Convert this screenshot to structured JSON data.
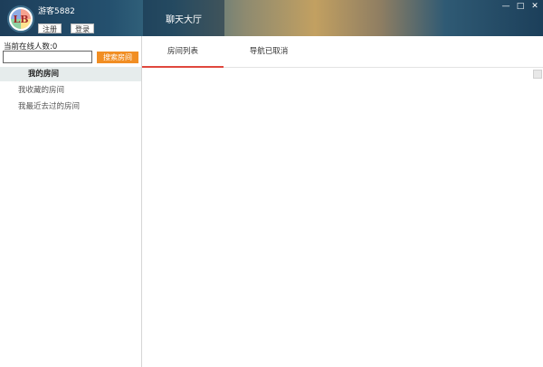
{
  "header": {
    "username": "游客5882",
    "register_label": "注册",
    "login_label": "登录",
    "hall_tab_label": "聊天大厅",
    "logo_text": "LB",
    "window_controls": {
      "minimize": "—",
      "maximize": "□",
      "close": "✕"
    }
  },
  "sidebar": {
    "online_count": "当前在线人数:0",
    "search_placeholder": "",
    "search_button": "搜索房间",
    "items": [
      {
        "label": "我的房间",
        "active": true
      },
      {
        "label": "我收藏的房间",
        "active": false
      },
      {
        "label": "我最近去过的房间",
        "active": false
      }
    ]
  },
  "main": {
    "tabs": [
      {
        "label": "房间列表",
        "active": true
      },
      {
        "label": "导航已取消",
        "active": false
      }
    ]
  },
  "colors": {
    "accent_orange": "#f18e23",
    "tab_underline": "#e0483e"
  }
}
